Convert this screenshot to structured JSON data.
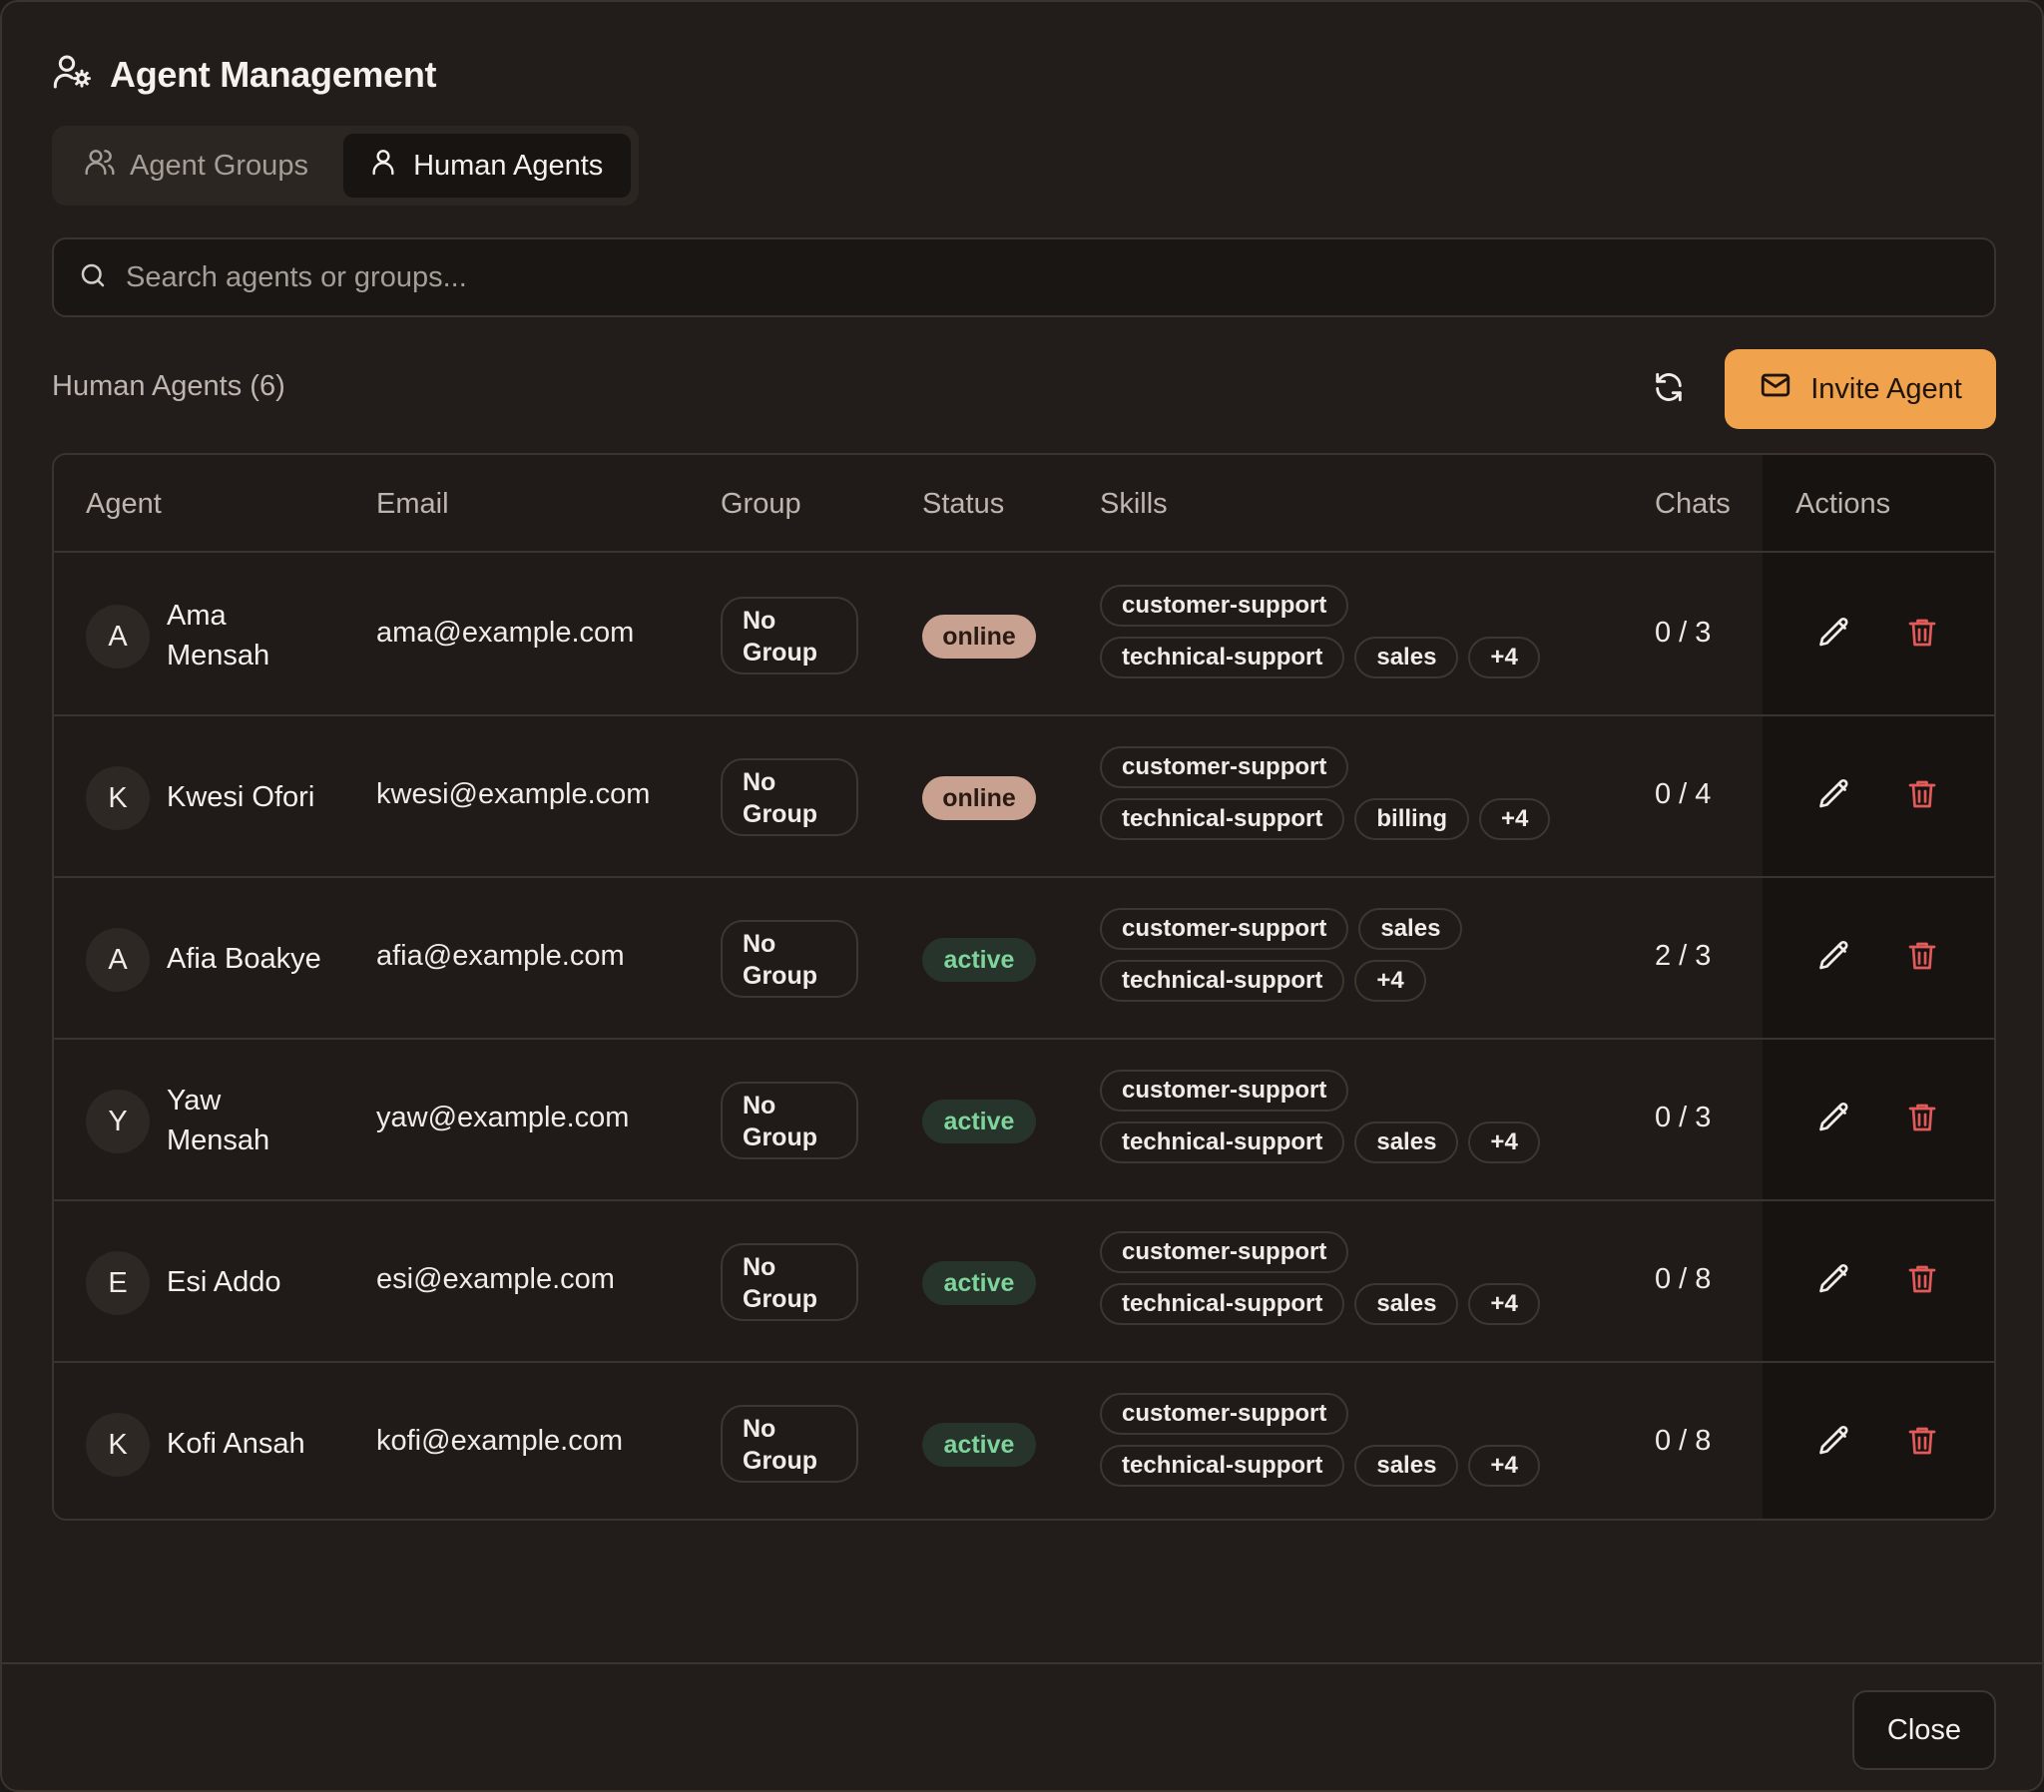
{
  "header": {
    "title": "Agent Management",
    "icon": "user-cog-icon"
  },
  "tabs": [
    {
      "label": "Agent Groups",
      "icon": "users-icon",
      "active": false
    },
    {
      "label": "Human Agents",
      "icon": "user-icon",
      "active": true
    }
  ],
  "search": {
    "placeholder": "Search agents or groups..."
  },
  "section": {
    "title": "Human Agents (6)"
  },
  "toolbar": {
    "invite_label": "Invite Agent",
    "refresh_icon": "refresh-icon",
    "invite_icon": "mail-icon"
  },
  "table": {
    "columns": [
      "Agent",
      "Email",
      "Group",
      "Status",
      "Skills",
      "Chats",
      "Actions"
    ],
    "rows": [
      {
        "initial": "A",
        "name": "Ama Mensah",
        "email": "ama@example.com",
        "group": "No Group",
        "status": "online",
        "skills": [
          "customer-support",
          "technical-support",
          "sales",
          "+4"
        ],
        "chats": "0 / 3"
      },
      {
        "initial": "K",
        "name": "Kwesi Ofori",
        "email": "kwesi@example.com",
        "group": "No Group",
        "status": "online",
        "skills": [
          "customer-support",
          "technical-support",
          "billing",
          "+4"
        ],
        "chats": "0 / 4"
      },
      {
        "initial": "A",
        "name": "Afia Boakye",
        "email": "afia@example.com",
        "group": "No Group",
        "status": "active",
        "skills": [
          "customer-support",
          "sales",
          "technical-support",
          "+4"
        ],
        "chats": "2 / 3"
      },
      {
        "initial": "Y",
        "name": "Yaw Mensah",
        "email": "yaw@example.com",
        "group": "No Group",
        "status": "active",
        "skills": [
          "customer-support",
          "technical-support",
          "sales",
          "+4"
        ],
        "chats": "0 / 3"
      },
      {
        "initial": "E",
        "name": "Esi Addo",
        "email": "esi@example.com",
        "group": "No Group",
        "status": "active",
        "skills": [
          "customer-support",
          "technical-support",
          "sales",
          "+4"
        ],
        "chats": "0 / 8"
      },
      {
        "initial": "K",
        "name": "Kofi Ansah",
        "email": "kofi@example.com",
        "group": "No Group",
        "status": "active",
        "skills": [
          "customer-support",
          "technical-support",
          "sales",
          "+4"
        ],
        "chats": "0 / 8"
      }
    ]
  },
  "footer": {
    "close_label": "Close"
  },
  "colors": {
    "accent": "#f0a24d",
    "online_bg": "#c9a190",
    "active_bg": "#27342b",
    "active_text": "#7ed49a",
    "danger": "#e25a5a"
  }
}
